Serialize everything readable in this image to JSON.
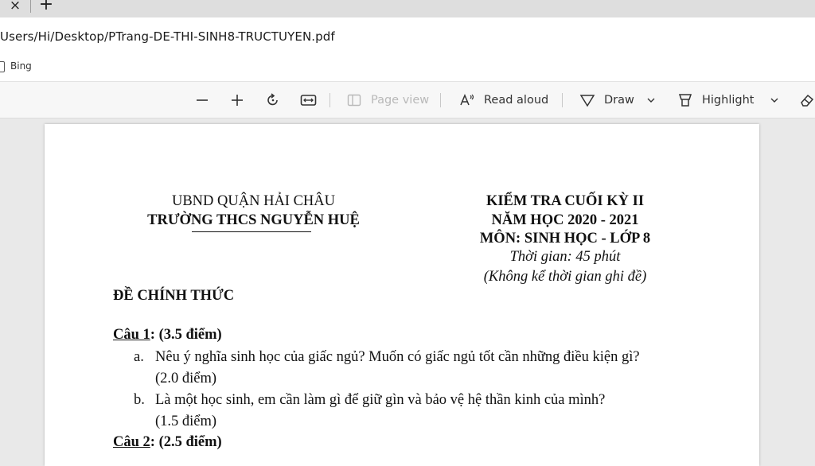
{
  "tabbar": {
    "close_glyph": "×",
    "new_tab_glyph": "+"
  },
  "address": {
    "url": "Users/Hi/Desktop/PTrang-DE-THI-SINH8-TRUCTUYEN.pdf"
  },
  "favorites": {
    "items": [
      {
        "label": "Bing",
        "icon": "bookmark-icon"
      }
    ]
  },
  "toolbar": {
    "page_view_label": "Page view",
    "read_aloud_label": "Read aloud",
    "draw_label": "Draw",
    "highlight_label": "Highlight"
  },
  "document": {
    "left_header": {
      "line1": "UBND QUẬN HẢI CHÂU",
      "line2": "TRƯỜNG THCS NGUYỄN HUỆ"
    },
    "right_header": {
      "line1": "KIỂM TRA CUỐI KỲ II",
      "line2": "NĂM HỌC 2020 - 2021",
      "line3": "MÔN: SINH HỌC -  LỚP 8",
      "line4": "Thời gian: 45 phút",
      "line5": "(Không kể thời gian ghi đề)"
    },
    "official_label": "ĐỀ CHÍNH THỨC",
    "questions": [
      {
        "label": "Câu 1",
        "points": ": (3.5 điểm)",
        "items": [
          {
            "marker": "a.",
            "text": "Nêu ý nghĩa sinh học của giấc ngủ? Muốn có giấc ngủ tốt cần những điều kiện gì?",
            "points": "(2.0 điểm)"
          },
          {
            "marker": "b.",
            "text": "Là một học sinh, em cần làm gì để giữ gìn và bảo vệ hệ thần kinh của mình?",
            "points": "(1.5 điểm)"
          }
        ]
      },
      {
        "label": "Câu 2",
        "points": ": (2.5 điểm)"
      }
    ]
  }
}
